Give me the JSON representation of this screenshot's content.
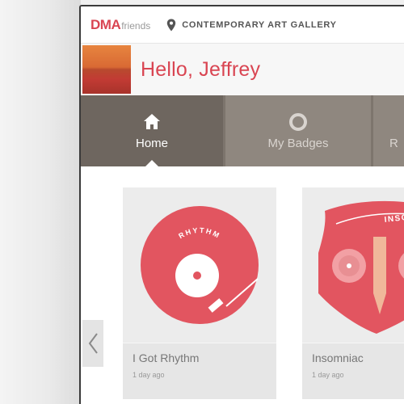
{
  "header": {
    "logo_main": "DMA",
    "logo_sub": "friends",
    "location": "CONTEMPORARY ART GALLERY"
  },
  "greeting": {
    "text": "Hello, Jeffrey"
  },
  "nav": {
    "tabs": [
      {
        "label": "Home",
        "icon": "home-icon",
        "active": true
      },
      {
        "label": "My Badges",
        "icon": "badge-icon",
        "active": false
      },
      {
        "label": "R",
        "icon": "",
        "active": false
      }
    ]
  },
  "badges": [
    {
      "title": "I Got Rhythm",
      "time": "1 day ago",
      "art_text": "RHYTHM",
      "icon": "vinyl-record-icon"
    },
    {
      "title": "Insomniac",
      "time": "1 day ago",
      "art_text": "INSOMNIA",
      "icon": "shield-badge-icon"
    }
  ],
  "colors": {
    "brand_red": "#d94552",
    "nav_bg": "#7d756d",
    "nav_active": "#6e665f",
    "card_bg": "#ececec"
  }
}
